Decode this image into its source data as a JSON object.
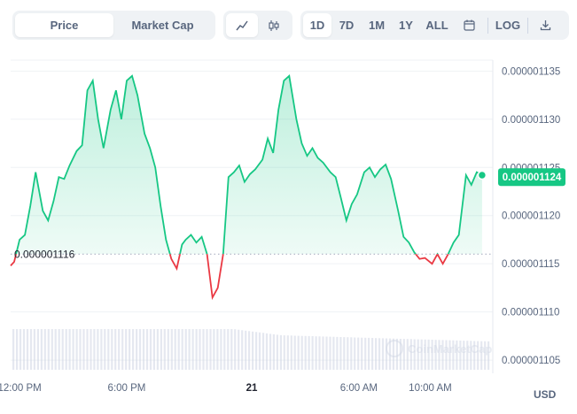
{
  "toolbar": {
    "metric_tabs": [
      {
        "label": "Price",
        "active": true
      },
      {
        "label": "Market Cap",
        "active": false
      }
    ],
    "chart_style_icons": [
      "line-chart-icon",
      "candlestick-icon"
    ],
    "ranges": [
      {
        "label": "1D",
        "active": true
      },
      {
        "label": "7D",
        "active": false
      },
      {
        "label": "1M",
        "active": false
      },
      {
        "label": "1Y",
        "active": false
      },
      {
        "label": "ALL",
        "active": false
      }
    ],
    "calendar_icon": "calendar-icon",
    "log_label": "LOG",
    "download_icon": "download-icon"
  },
  "currency_label": "USD",
  "watermark": "CoinMarketCap",
  "colors": {
    "up": "#16c784",
    "down": "#ea3943",
    "grid": "#eff2f5",
    "axis_text": "#58667e",
    "volume": "#cfd6e4"
  },
  "chart_data": {
    "type": "area",
    "title": "",
    "xlabel": "",
    "ylabel": "",
    "y_ticks": [
      "0.000001105",
      "0.000001110",
      "0.000001115",
      "0.000001120",
      "0.000001125",
      "0.000001130",
      "0.000001135"
    ],
    "ylim": [
      1.104e-06,
      1.1365e-06
    ],
    "x_ticks": [
      {
        "label": "12:00 PM",
        "t": 0.5
      },
      {
        "label": "6:00 PM",
        "t": 6.5
      },
      {
        "label": "21",
        "t": 13.5
      },
      {
        "label": "6:00 AM",
        "t": 19.5
      },
      {
        "label": "10:00 AM",
        "t": 23.5
      }
    ],
    "xlim": [
      0,
      27
    ],
    "reference_price": 1.116e-06,
    "reference_label": "0.000001116",
    "current_price": 1.124e-06,
    "current_label": "0.000001124",
    "grid": true,
    "price_series": {
      "name": "Price",
      "t": [
        0.0,
        0.2,
        0.5,
        0.8,
        1.1,
        1.4,
        1.8,
        2.1,
        2.4,
        2.7,
        3.0,
        3.3,
        3.7,
        4.0,
        4.3,
        4.6,
        4.9,
        5.2,
        5.6,
        5.9,
        6.2,
        6.5,
        6.8,
        7.1,
        7.5,
        7.8,
        8.1,
        8.4,
        8.7,
        9.0,
        9.3,
        9.6,
        9.8,
        10.1,
        10.4,
        10.7,
        11.0,
        11.3,
        11.6,
        11.9,
        12.2,
        12.5,
        12.8,
        13.1,
        13.4,
        13.7,
        14.1,
        14.4,
        14.7,
        15.0,
        15.3,
        15.6,
        16.0,
        16.3,
        16.6,
        16.9,
        17.2,
        17.5,
        17.9,
        18.2,
        18.5,
        18.8,
        19.1,
        19.4,
        19.8,
        20.1,
        20.4,
        20.7,
        21.0,
        21.3,
        21.7,
        22.0,
        22.3,
        22.6,
        22.9,
        23.2,
        23.6,
        23.9,
        24.2,
        24.5,
        24.8,
        25.1,
        25.5,
        25.8,
        26.1,
        26.4
      ],
      "values": [
        1.1148e-06,
        1.1152e-06,
        1.1175e-06,
        1.118e-06,
        1.121e-06,
        1.1245e-06,
        1.1205e-06,
        1.1195e-06,
        1.1215e-06,
        1.124e-06,
        1.1238e-06,
        1.1252e-06,
        1.1267e-06,
        1.1273e-06,
        1.133e-06,
        1.134e-06,
        1.13e-06,
        1.127e-06,
        1.131e-06,
        1.133e-06,
        1.13e-06,
        1.134e-06,
        1.1345e-06,
        1.1325e-06,
        1.1285e-06,
        1.127e-06,
        1.125e-06,
        1.121e-06,
        1.1175e-06,
        1.1155e-06,
        1.1145e-06,
        1.117e-06,
        1.1175e-06,
        1.118e-06,
        1.1172e-06,
        1.1178e-06,
        1.116e-06,
        1.1115e-06,
        1.1125e-06,
        1.116e-06,
        1.124e-06,
        1.1245e-06,
        1.1252e-06,
        1.1235e-06,
        1.1243e-06,
        1.1248e-06,
        1.1258e-06,
        1.128e-06,
        1.1265e-06,
        1.131e-06,
        1.134e-06,
        1.1345e-06,
        1.13e-06,
        1.1275e-06,
        1.1262e-06,
        1.127e-06,
        1.126e-06,
        1.1255e-06,
        1.1245e-06,
        1.124e-06,
        1.1218e-06,
        1.1195e-06,
        1.1212e-06,
        1.1222e-06,
        1.1245e-06,
        1.125e-06,
        1.124e-06,
        1.1248e-06,
        1.1253e-06,
        1.1238e-06,
        1.1205e-06,
        1.1178e-06,
        1.1172e-06,
        1.1162e-06,
        1.1155e-06,
        1.1156e-06,
        1.115e-06,
        1.116e-06,
        1.115e-06,
        1.116e-06,
        1.1172e-06,
        1.118e-06,
        1.1242e-06,
        1.1232e-06,
        1.1245e-06,
        1.1242e-06
      ]
    }
  }
}
